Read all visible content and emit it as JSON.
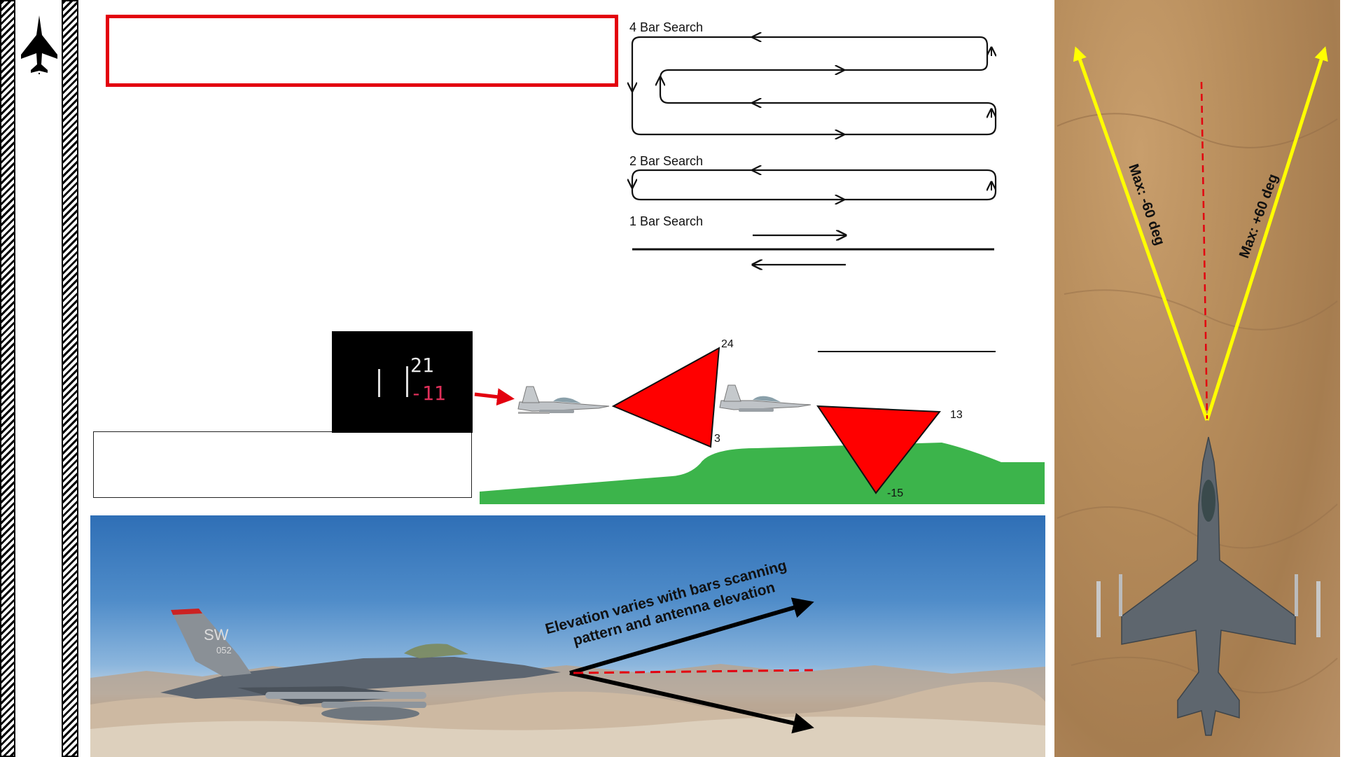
{
  "scan_patterns": {
    "bar4": "4 Bar Search",
    "bar2": "2 Bar Search",
    "bar1": "1 Bar Search"
  },
  "elevation_diagram": {
    "mfd_upper": "21",
    "mfd_lower": "-11",
    "wedge1_top": "24",
    "wedge1_bottom": "3",
    "wedge2_right": "13",
    "wedge2_bottom": "-15"
  },
  "azimuth": {
    "left_limit": "Max: -60 deg",
    "right_limit": "Max: +60 deg"
  },
  "photo": {
    "caption_line1": "Elevation varies with bars scanning",
    "caption_line2": "pattern and antenna elevation",
    "tail_code": "SW",
    "tail_number": "052"
  },
  "colors": {
    "highlight_red": "#e3000f",
    "wedge_red": "#ff0000",
    "terrain_green": "#3cb44b",
    "azimuth_yellow": "#ffff00"
  }
}
